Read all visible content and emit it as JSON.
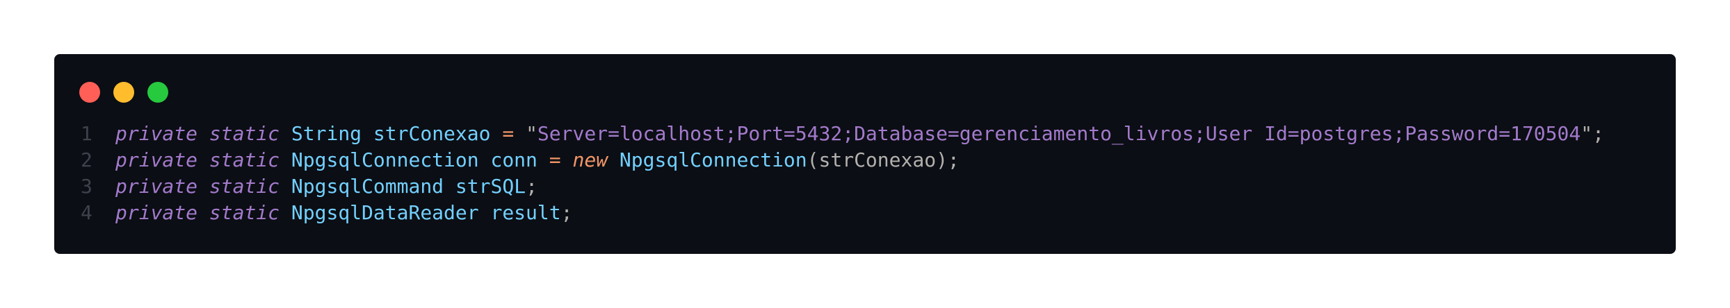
{
  "window": {
    "controls": [
      {
        "name": "close",
        "color": "#ff5f56"
      },
      {
        "name": "minimize",
        "color": "#ffbd2e"
      },
      {
        "name": "maximize",
        "color": "#27c93f"
      }
    ]
  },
  "code": {
    "lines": [
      {
        "number": "1",
        "tokens": [
          {
            "t": "private",
            "c": "kw"
          },
          {
            "t": " ",
            "c": "punct"
          },
          {
            "t": "static",
            "c": "kw"
          },
          {
            "t": " ",
            "c": "punct"
          },
          {
            "t": "String",
            "c": "type"
          },
          {
            "t": " ",
            "c": "punct"
          },
          {
            "t": "strConexao",
            "c": "ident"
          },
          {
            "t": " ",
            "c": "punct"
          },
          {
            "t": "=",
            "c": "op"
          },
          {
            "t": " ",
            "c": "punct"
          },
          {
            "t": "\"",
            "c": "quote"
          },
          {
            "t": "Server=localhost;Port=5432;Database=gerenciamento_livros;User Id=postgres;Password=170504",
            "c": "str"
          },
          {
            "t": "\"",
            "c": "quote"
          },
          {
            "t": ";",
            "c": "punct"
          }
        ]
      },
      {
        "number": "2",
        "tokens": [
          {
            "t": "private",
            "c": "kw"
          },
          {
            "t": " ",
            "c": "punct"
          },
          {
            "t": "static",
            "c": "kw"
          },
          {
            "t": " ",
            "c": "punct"
          },
          {
            "t": "NpgsqlConnection",
            "c": "type"
          },
          {
            "t": " ",
            "c": "punct"
          },
          {
            "t": "conn",
            "c": "ident"
          },
          {
            "t": " ",
            "c": "punct"
          },
          {
            "t": "=",
            "c": "op"
          },
          {
            "t": " ",
            "c": "punct"
          },
          {
            "t": "new",
            "c": "op"
          },
          {
            "t": " ",
            "c": "punct"
          },
          {
            "t": "NpgsqlConnection",
            "c": "type"
          },
          {
            "t": "(strConexao);",
            "c": "punct"
          }
        ]
      },
      {
        "number": "3",
        "tokens": [
          {
            "t": "private",
            "c": "kw"
          },
          {
            "t": " ",
            "c": "punct"
          },
          {
            "t": "static",
            "c": "kw"
          },
          {
            "t": " ",
            "c": "punct"
          },
          {
            "t": "NpgsqlCommand",
            "c": "type"
          },
          {
            "t": " ",
            "c": "punct"
          },
          {
            "t": "strSQL",
            "c": "ident"
          },
          {
            "t": ";",
            "c": "punct"
          }
        ]
      },
      {
        "number": "4",
        "tokens": [
          {
            "t": "private",
            "c": "kw"
          },
          {
            "t": " ",
            "c": "punct"
          },
          {
            "t": "static",
            "c": "kw"
          },
          {
            "t": " ",
            "c": "punct"
          },
          {
            "t": "NpgsqlDataReader",
            "c": "type"
          },
          {
            "t": " ",
            "c": "punct"
          },
          {
            "t": "result",
            "c": "ident"
          },
          {
            "t": ";",
            "c": "punct"
          }
        ]
      }
    ]
  }
}
